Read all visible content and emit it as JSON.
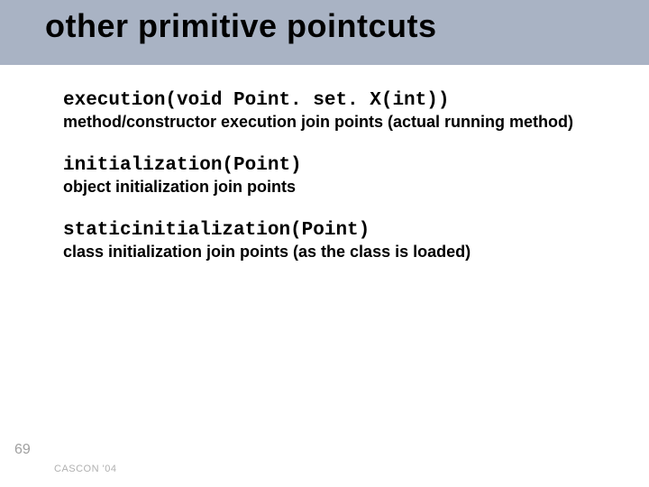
{
  "title": "other primitive pointcuts",
  "items": [
    {
      "code": "execution(void Point. set. X(int))",
      "desc": "method/constructor execution join points (actual running method)"
    },
    {
      "code": "initialization(Point)",
      "desc": "object initialization join points"
    },
    {
      "code": "staticinitialization(Point)",
      "desc": "class initialization join points (as the class is loaded)"
    }
  ],
  "pageNumber": "69",
  "footer": "CASCON '04"
}
